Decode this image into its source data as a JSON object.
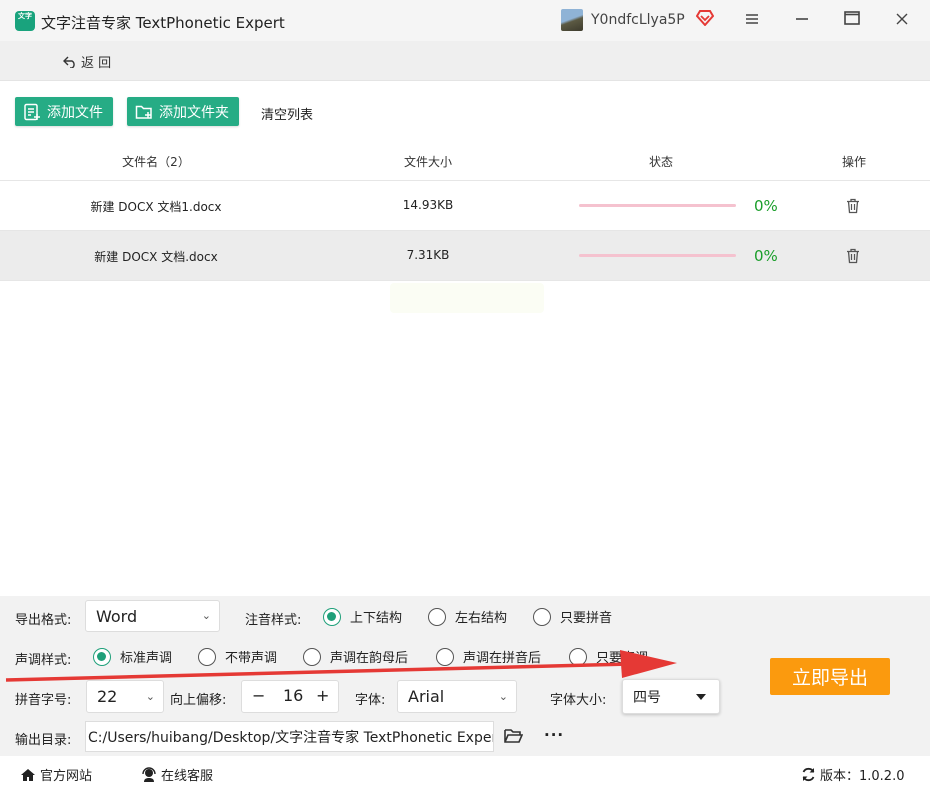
{
  "app": {
    "title": "文字注音专家 TextPhonetic Expert",
    "logo_text": "文字",
    "username": "Y0ndfcLlya5P"
  },
  "nav": {
    "back_label": "返 回"
  },
  "toolbar": {
    "add_file": "添加文件",
    "add_folder": "添加文件夹",
    "clear_list": "清空列表"
  },
  "table": {
    "headers": [
      "文件名（2）",
      "文件大小",
      "状态",
      "操作"
    ],
    "rows": [
      {
        "name": "新建 DOCX 文档1.docx",
        "size": "14.93KB",
        "progress": 0,
        "percent": "0%"
      },
      {
        "name": "新建 DOCX 文档.docx",
        "size": "7.31KB",
        "progress": 0,
        "percent": "0%"
      }
    ]
  },
  "settings": {
    "export_format_label": "导出格式:",
    "export_format_value": "Word",
    "annotation_style_label": "注音样式:",
    "annotation_options": [
      "上下结构",
      "左右结构",
      "只要拼音"
    ],
    "annotation_selected": "上下结构",
    "tone_style_label": "声调样式:",
    "tone_options": [
      "标准声调",
      "不带声调",
      "声调在韵母后",
      "声调在拼音后",
      "只要声调"
    ],
    "tone_selected": "标准声调",
    "pinyin_size_label": "拼音字号:",
    "pinyin_size_value": "22",
    "offset_label": "向上偏移:",
    "offset_value": "16",
    "offset_minus": "−",
    "offset_plus": "+",
    "font_label": "字体:",
    "font_value": "Arial",
    "font_size_label": "字体大小:",
    "font_size_value": "四号",
    "output_dir_label": "输出目录:",
    "output_dir_value": "C:/Users/huibang/Desktop/文字注音专家 TextPhonetic Expert",
    "more_label": "···",
    "export_button": "立即导出"
  },
  "statusbar": {
    "website": "官方网站",
    "support": "在线客服",
    "version": "版本：1.0.2.0"
  },
  "colors": {
    "accent_green": "#26ac85",
    "export_orange": "#fb9a0e",
    "percent_green": "#1a9e2a",
    "progress_track": "#f5c2cf",
    "arrow_red": "#e53935"
  }
}
